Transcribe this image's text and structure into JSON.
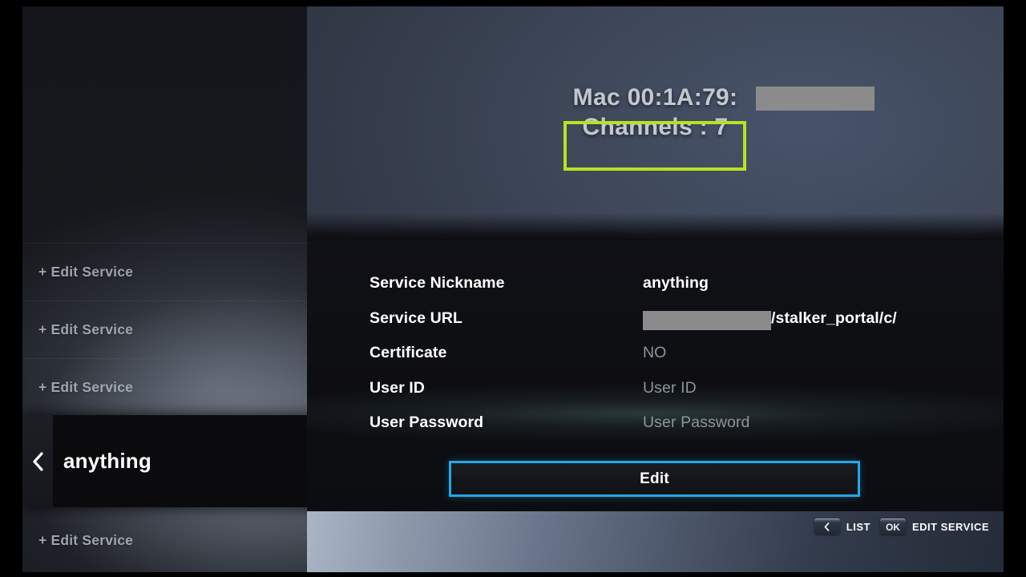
{
  "sidebar": {
    "items": [
      {
        "label": "+ Edit Service"
      },
      {
        "label": "+ Edit Service"
      },
      {
        "label": "+ Edit Service"
      },
      {
        "label": "+ Edit Service"
      }
    ],
    "selected": {
      "name": "anything",
      "back_icon": "chevron-left-icon",
      "badge_icon": "monitor-icon"
    }
  },
  "header": {
    "mac_label": "Mac 00:1A:79:",
    "mac_redacted": true,
    "channels_text": "Channels : 7",
    "highlight_color": "#b7e222"
  },
  "form": {
    "fields": [
      {
        "label": "Service Nickname",
        "value": "anything",
        "state": "filled"
      },
      {
        "label": "Service URL",
        "value": "/stalker_portal/c/",
        "state": "filled",
        "redacted_prefix": true
      },
      {
        "label": "Certificate",
        "value": "NO",
        "state": "placeholder"
      },
      {
        "label": "User ID",
        "value": "User ID",
        "state": "placeholder"
      },
      {
        "label": "User Password",
        "value": "User Password",
        "state": "placeholder"
      }
    ]
  },
  "actions": {
    "edit_label": "Edit",
    "focus_color": "#1fa8e8"
  },
  "hints": [
    {
      "key": "<",
      "key_icon": "chevron-left-icon",
      "label": "LIST"
    },
    {
      "key": "OK",
      "key_icon": "",
      "label": "EDIT SERVICE"
    }
  ]
}
